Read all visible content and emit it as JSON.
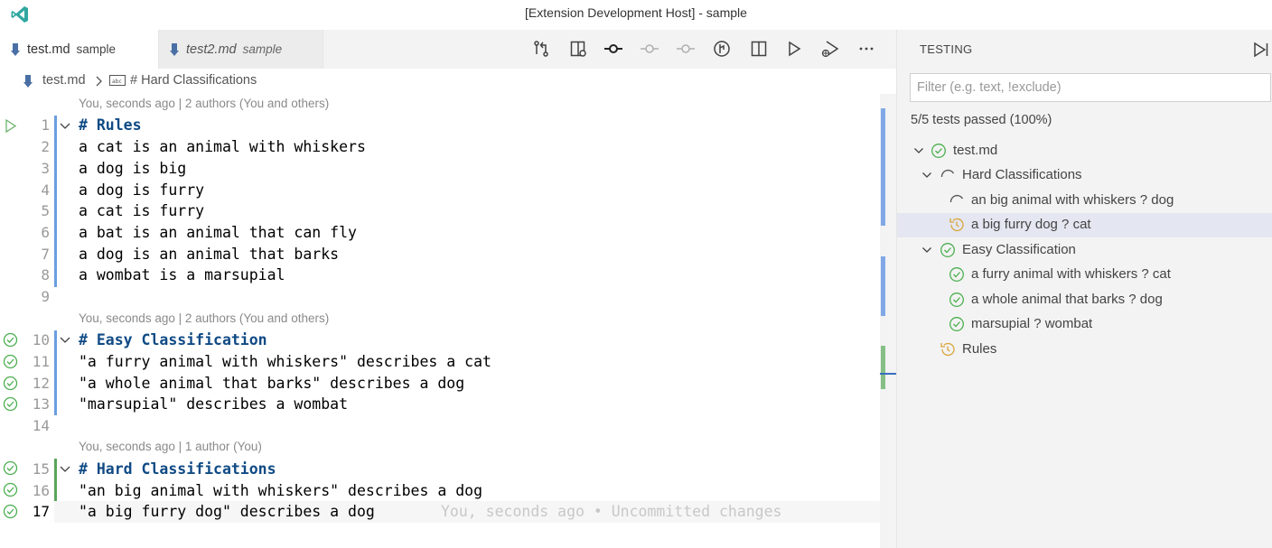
{
  "window": {
    "title": "[Extension Development Host] - sample"
  },
  "tabs": [
    {
      "name": "test.md",
      "desc": "sample"
    },
    {
      "name": "test2.md",
      "desc": "sample"
    }
  ],
  "toolbar": {
    "icons": [
      "open-changes-icon",
      "open-file-icon",
      "git-commit-icon",
      "previous-change-icon",
      "next-change-icon",
      "git-graph-icon",
      "split-editor-icon",
      "run-icon",
      "debug-run-icon",
      "more-actions-icon"
    ]
  },
  "breadcrumb": {
    "file": "test.md",
    "symbol": "# Hard Classifications"
  },
  "editor": {
    "codelens": [
      "You, seconds ago | 2 authors (You and others)",
      "You, seconds ago | 2 authors (You and others)",
      "You, seconds ago | 1 author (You)"
    ],
    "lines": [
      {
        "n": "1",
        "text": "# Rules"
      },
      {
        "n": "2",
        "text": "a cat is an animal with whiskers"
      },
      {
        "n": "3",
        "text": "a dog is big"
      },
      {
        "n": "4",
        "text": "a dog is furry"
      },
      {
        "n": "5",
        "text": "a cat is furry"
      },
      {
        "n": "6",
        "text": "a bat is an animal that can fly"
      },
      {
        "n": "7",
        "text": "a dog is an animal that barks"
      },
      {
        "n": "8",
        "text": "a wombat is a marsupial"
      },
      {
        "n": "9",
        "text": ""
      },
      {
        "n": "10",
        "text": "# Easy Classification"
      },
      {
        "n": "11",
        "text": "\"a furry animal with whiskers\" describes a cat"
      },
      {
        "n": "12",
        "text": "\"a whole animal that barks\" describes a dog"
      },
      {
        "n": "13",
        "text": "\"marsupial\" describes a wombat"
      },
      {
        "n": "14",
        "text": ""
      },
      {
        "n": "15",
        "text": "# Hard Classifications"
      },
      {
        "n": "16",
        "text": "\"an big animal with whiskers\" describes a dog"
      },
      {
        "n": "17",
        "text": "\"a big furry dog\" describes a dog"
      }
    ],
    "blame": "You, seconds ago • Uncommitted changes"
  },
  "testing": {
    "title": "TESTING",
    "filter_placeholder": "Filter (e.g. text, !exclude)",
    "summary": "5/5 tests passed (100%)",
    "tree": [
      {
        "label": "test.md",
        "status": "passed"
      },
      {
        "label": "Hard Classifications",
        "status": "running"
      },
      {
        "label": "an big animal with whiskers ? dog",
        "status": "running"
      },
      {
        "label": "a big furry dog ? cat",
        "status": "queued"
      },
      {
        "label": "Easy Classification",
        "status": "passed"
      },
      {
        "label": "a furry animal with whiskers ? cat",
        "status": "passed"
      },
      {
        "label": "a whole animal that barks ? dog",
        "status": "passed"
      },
      {
        "label": "marsupial ? wombat",
        "status": "passed"
      },
      {
        "label": "Rules",
        "status": "queued"
      }
    ]
  },
  "colors": {
    "accent": "#0066b8",
    "passed": "#4caf50",
    "queued": "#d9a53a",
    "heading": "#0f4a85",
    "gitModified": "#6a9fe0",
    "gitAdded": "#5aa55a"
  }
}
